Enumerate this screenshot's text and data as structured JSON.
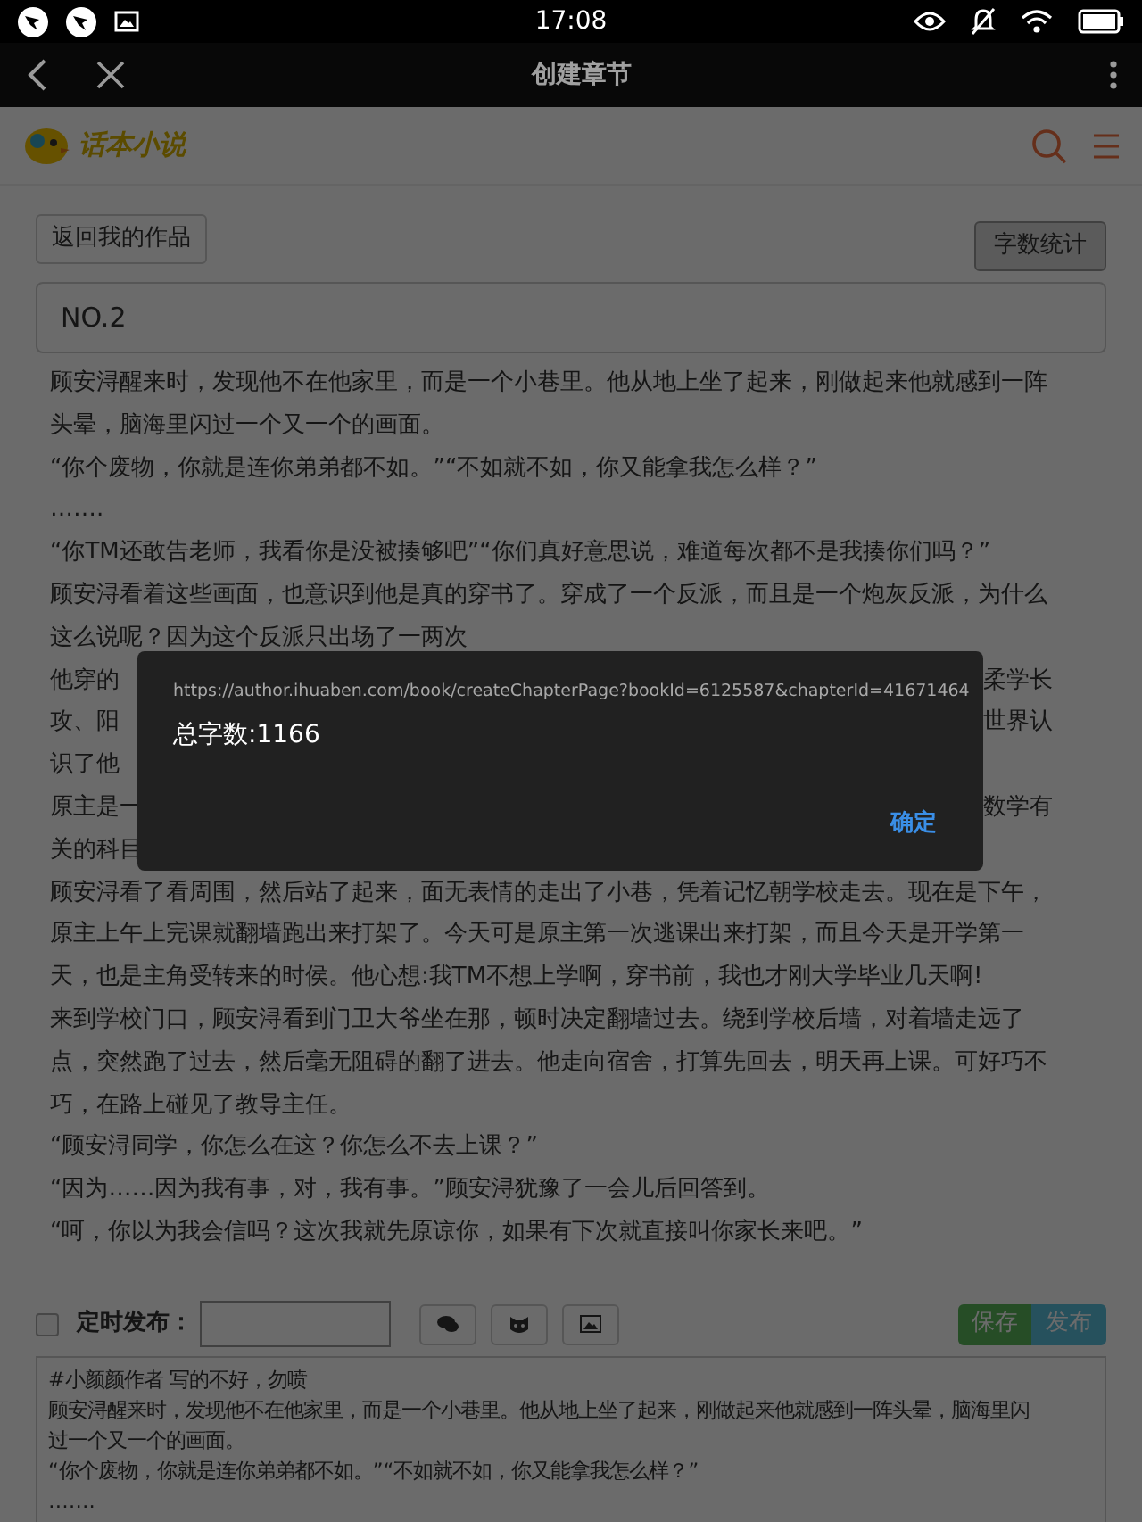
{
  "status_bar": {
    "time": "17:08"
  },
  "app_bar": {
    "title": "创建章节"
  },
  "header": {
    "logo_text": "话本小说"
  },
  "back_button": "返回我的作品",
  "count_button": "字数统计",
  "chapter_title": {
    "value": "NO.2"
  },
  "article_lines": [
    {
      "kind": "full",
      "text": "顾安浔醒来时，发现他不在他家里，而是一个小巷里。他从地上坐了起来，刚做起来他就感到一阵"
    },
    {
      "kind": "full",
      "text": "头晕，脑海里闪过一个又一个的画面。"
    },
    {
      "kind": "full",
      "text": "“你个废物，你就是连你弟弟都不如。”“不如就不如，你又能拿我怎么样？”"
    },
    {
      "kind": "full",
      "text": "……."
    },
    {
      "kind": "full",
      "text": "“你TM还敢告老师，我看你是没被揍够吧”“你们真好意思说，难道每次都不是我揍你们吗？”"
    },
    {
      "kind": "full",
      "text": "顾安浔看着这些画面，也意识到他是真的穿书了。穿成了一个反派，而且是一个炮灰反派，为什么"
    },
    {
      "kind": "full",
      "text": "这么说呢？因为这个反派只出场了一两次"
    },
    {
      "kind": "split",
      "left": "他穿的",
      "right": "柔学长"
    },
    {
      "kind": "split",
      "left": "攻、阳",
      "right": "世界认"
    },
    {
      "kind": "split",
      "left": "识了他"
    },
    {
      "kind": "split",
      "left": "原主是一",
      "right": "数学有"
    },
    {
      "kind": "split",
      "left": "关的科目"
    },
    {
      "kind": "full",
      "text": "顾安浔看了看周围，然后站了起来，面无表情的走出了小巷，凭着记忆朝学校走去。现在是下午，"
    },
    {
      "kind": "full",
      "text": "原主上午上完课就翻墙跑出来打架了。今天可是原主第一次逃课出来打架，而且今天是开学第一"
    },
    {
      "kind": "full",
      "text": "天，也是主角受转来的时侯。他心想:我TM不想上学啊，穿书前，我也才刚大学毕业几天啊!"
    },
    {
      "kind": "full",
      "text": "来到学校门口，顾安浔看到门卫大爷坐在那，顿时决定翻墙过去。绕到学校后墙，对着墙走远了"
    },
    {
      "kind": "full",
      "text": "点，突然跑了过去，然后毫无阻碍的翻了进去。他走向宿舍，打算先回去，明天再上课。可好巧不"
    },
    {
      "kind": "full",
      "text": "巧，在路上碰见了教导主任。"
    },
    {
      "kind": "full",
      "text": "“顾安浔同学，你怎么在这？你怎么不去上课？”"
    },
    {
      "kind": "full",
      "text": "“因为……因为我有事，对，我有事。”顾安浔犹豫了一会儿后回答到。"
    },
    {
      "kind": "full",
      "text": "“呵，你以为我会信吗？这次我就先原谅你，如果有下次就直接叫你家长来吧。”"
    }
  ],
  "schedule": {
    "checked": false,
    "label": "定时发布："
  },
  "save_button": "保存",
  "publish_button": "发布",
  "editor_lines": [
    "#小颜颜作者 写的不好，勿喷",
    "顾安浔醒来时，发现他不在他家里，而是一个小巷里。他从地上坐了起来，刚做起来他就感到一阵头晕，脑海里闪",
    "过一个又一个的画面。",
    "“你个废物，你就是连你弟弟都不如。”“不如就不如，你又能拿我怎么样？”",
    "……."
  ],
  "dialog": {
    "url": "https://author.ihuaben.com/book/createChapterPage?bookId=6125587&chapterId=41671464",
    "message": "总字数:1166",
    "ok": "确定"
  }
}
